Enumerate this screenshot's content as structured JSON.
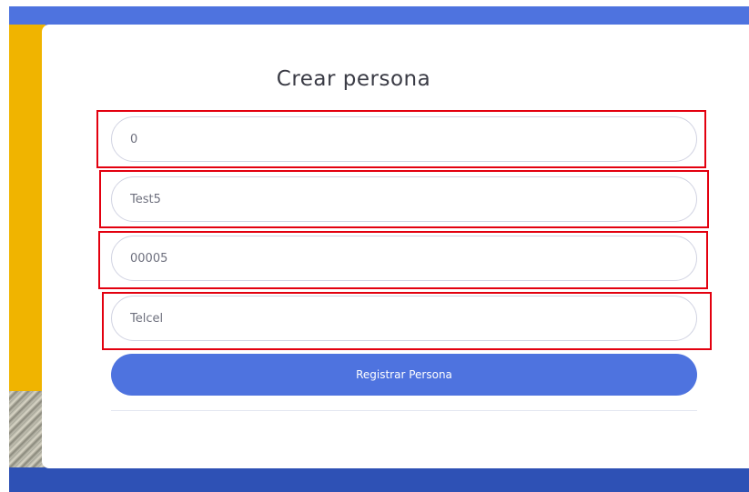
{
  "form": {
    "title": "Crear persona",
    "fields": [
      {
        "name": "id",
        "value": "0"
      },
      {
        "name": "name",
        "value": "Test5"
      },
      {
        "name": "code",
        "value": "00005"
      },
      {
        "name": "carrier",
        "value": "Telcel"
      }
    ],
    "submit_label": "Registrar Persona"
  },
  "colors": {
    "primary": "#4e73df",
    "primary_dark": "#2e51b5",
    "accent_yellow": "#f0b400",
    "highlight": "#e3000f"
  }
}
